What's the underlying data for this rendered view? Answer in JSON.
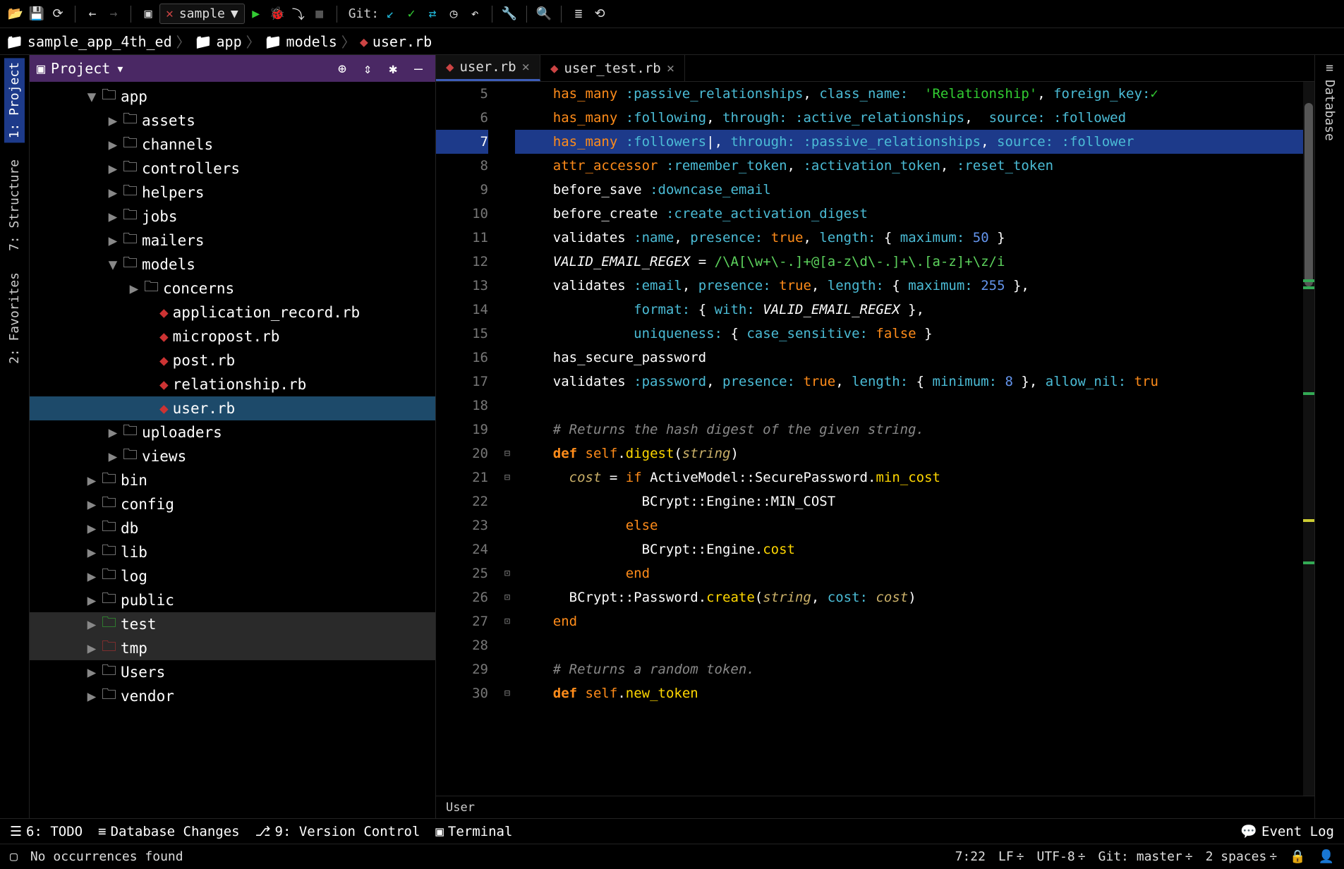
{
  "toolbar": {
    "run_config": "sample",
    "git_label": "Git:"
  },
  "breadcrumbs": [
    {
      "icon": "folder",
      "label": "sample_app_4th_ed"
    },
    {
      "icon": "folder",
      "label": "app"
    },
    {
      "icon": "folder",
      "label": "models"
    },
    {
      "icon": "ruby",
      "label": "user.rb"
    }
  ],
  "left_tabs": [
    {
      "label": "1: Project",
      "active": true
    },
    {
      "label": "7: Structure",
      "active": false
    },
    {
      "label": "2: Favorites",
      "active": false
    }
  ],
  "right_tabs": [
    {
      "label": "Database"
    }
  ],
  "project_panel": {
    "title": "Project",
    "tree": [
      {
        "indent": 80,
        "expand": "▼",
        "icon": "folder",
        "label": "app"
      },
      {
        "indent": 110,
        "expand": "▶",
        "icon": "folder",
        "label": "assets"
      },
      {
        "indent": 110,
        "expand": "▶",
        "icon": "folder",
        "label": "channels"
      },
      {
        "indent": 110,
        "expand": "▶",
        "icon": "folder",
        "label": "controllers"
      },
      {
        "indent": 110,
        "expand": "▶",
        "icon": "folder",
        "label": "helpers"
      },
      {
        "indent": 110,
        "expand": "▶",
        "icon": "folder",
        "label": "jobs"
      },
      {
        "indent": 110,
        "expand": "▶",
        "icon": "folder",
        "label": "mailers"
      },
      {
        "indent": 110,
        "expand": "▼",
        "icon": "folder",
        "label": "models"
      },
      {
        "indent": 140,
        "expand": "▶",
        "icon": "folder",
        "label": "concerns"
      },
      {
        "indent": 162,
        "expand": "",
        "icon": "ruby",
        "label": "application_record.rb"
      },
      {
        "indent": 162,
        "expand": "",
        "icon": "ruby",
        "label": "micropost.rb"
      },
      {
        "indent": 162,
        "expand": "",
        "icon": "ruby",
        "label": "post.rb"
      },
      {
        "indent": 162,
        "expand": "",
        "icon": "ruby",
        "label": "relationship.rb"
      },
      {
        "indent": 162,
        "expand": "",
        "icon": "ruby",
        "label": "user.rb",
        "selected": true
      },
      {
        "indent": 110,
        "expand": "▶",
        "icon": "folder",
        "label": "uploaders"
      },
      {
        "indent": 110,
        "expand": "▶",
        "icon": "folder",
        "label": "views"
      },
      {
        "indent": 80,
        "expand": "▶",
        "icon": "folder",
        "label": "bin"
      },
      {
        "indent": 80,
        "expand": "▶",
        "icon": "folder",
        "label": "config"
      },
      {
        "indent": 80,
        "expand": "▶",
        "icon": "folder",
        "label": "db"
      },
      {
        "indent": 80,
        "expand": "▶",
        "icon": "folder",
        "label": "lib"
      },
      {
        "indent": 80,
        "expand": "▶",
        "icon": "folder",
        "label": "log"
      },
      {
        "indent": 80,
        "expand": "▶",
        "icon": "folder",
        "label": "public"
      },
      {
        "indent": 80,
        "expand": "▶",
        "icon": "folder-test",
        "label": "test",
        "cls": "test dim"
      },
      {
        "indent": 80,
        "expand": "▶",
        "icon": "folder-tmp",
        "label": "tmp",
        "cls": "tmp dim"
      },
      {
        "indent": 80,
        "expand": "▶",
        "icon": "folder",
        "label": "Users"
      },
      {
        "indent": 80,
        "expand": "▶",
        "icon": "folder",
        "label": "vendor"
      }
    ]
  },
  "editor_tabs": [
    {
      "icon": "ruby",
      "label": "user.rb",
      "active": true
    },
    {
      "icon": "ruby",
      "label": "user_test.rb",
      "active": false
    }
  ],
  "editor": {
    "first_line": 5,
    "current_line": 7,
    "fold_markers": {
      "20": "⊟",
      "21": "⊟",
      "25": "⊡",
      "26": "⊡",
      "27": "⊡",
      "30": "⊟"
    },
    "lines": [
      {
        "n": 5,
        "html": "    <span class='kw'>has_many</span> <span class='sym'>:passive_relationships</span><span class='punct'>,</span> <span class='sym'>class_name:</span>  <span class='str'>'Relationship'</span><span class='punct'>,</span> <span class='sym'>foreign_key:</span><span class='green-check'>✓</span>"
      },
      {
        "n": 6,
        "html": "    <span class='kw'>has_many</span> <span class='sym'>:following</span><span class='punct'>,</span> <span class='sym'>through:</span> <span class='sym'>:active_relationships</span><span class='punct'>,</span>  <span class='sym'>source:</span> <span class='sym'>:followed</span>"
      },
      {
        "n": 7,
        "html": "    <span class='kw'>has_many</span> <span class='sym'>:followers</span><span class='punct'>|,</span> <span class='sym'>through:</span> <span class='sym'>:passive_relationships</span><span class='punct'>,</span> <span class='sym'>source:</span> <span class='sym'>:follower</span>"
      },
      {
        "n": 8,
        "html": "    <span class='kw'>attr_accessor</span> <span class='sym'>:remember_token</span><span class='punct'>,</span> <span class='sym'>:activation_token</span><span class='punct'>,</span> <span class='sym'>:reset_token</span>"
      },
      {
        "n": 9,
        "html": "    <span class='punct'>before_save</span> <span class='sym'>:downcase_email</span>"
      },
      {
        "n": 10,
        "html": "    <span class='punct'>before_create</span> <span class='sym'>:create_activation_digest</span>"
      },
      {
        "n": 11,
        "html": "    <span class='punct'>validates</span> <span class='sym'>:name</span><span class='punct'>,</span> <span class='sym'>presence:</span> <span class='kw'>true</span><span class='punct'>,</span> <span class='sym'>length:</span> <span class='punct'>{</span> <span class='sym'>maximum:</span> <span class='num'>50</span> <span class='punct'>}</span>"
      },
      {
        "n": 12,
        "html": "    <span class='const'>VALID_EMAIL_REGEX</span> <span class='punct'>=</span> <span class='regex'>/\\A[\\w+\\-.]+@[a-z\\d\\-.]+\\.[a-z]+\\z/i</span>"
      },
      {
        "n": 13,
        "html": "    <span class='punct'>validates</span> <span class='sym'>:email</span><span class='punct'>,</span> <span class='sym'>presence:</span> <span class='kw'>true</span><span class='punct'>,</span> <span class='sym'>length:</span> <span class='punct'>{</span> <span class='sym'>maximum:</span> <span class='num'>255</span> <span class='punct'>},</span>"
      },
      {
        "n": 14,
        "html": "              <span class='sym'>format:</span> <span class='punct'>{</span> <span class='sym'>with:</span> <span class='const'>VALID_EMAIL_REGEX</span> <span class='punct'>},</span>"
      },
      {
        "n": 15,
        "html": "              <span class='sym'>uniqueness:</span> <span class='punct'>{</span> <span class='sym'>case_sensitive:</span> <span class='kw'>false</span> <span class='punct'>}</span>"
      },
      {
        "n": 16,
        "html": "    <span class='punct'>has_secure_password</span>"
      },
      {
        "n": 17,
        "html": "    <span class='punct'>validates</span> <span class='sym'>:password</span><span class='punct'>,</span> <span class='sym'>presence:</span> <span class='kw'>true</span><span class='punct'>,</span> <span class='sym'>length:</span> <span class='punct'>{</span> <span class='sym'>minimum:</span> <span class='num'>8</span> <span class='punct'>},</span> <span class='sym'>allow_nil:</span> <span class='kw'>tru</span>"
      },
      {
        "n": 18,
        "html": ""
      },
      {
        "n": 19,
        "html": "    <span class='comment'># Returns the hash digest of the given string.</span>"
      },
      {
        "n": 20,
        "html": "    <span class='def'>def</span> <span class='kw'>self</span><span class='punct'>.</span><span class='method'>digest</span><span class='punct'>(</span><span class='param'>string</span><span class='punct'>)</span>"
      },
      {
        "n": 21,
        "html": "      <span class='param'>cost</span> <span class='punct'>=</span> <span class='kw'>if</span> <span class='const' style='font-style:normal'>ActiveModel</span><span class='punct'>::</span><span class='const' style='font-style:normal'>SecurePassword</span><span class='punct'>.</span><span class='method'>min_cost</span>"
      },
      {
        "n": 22,
        "html": "               <span class='const' style='font-style:normal'>BCrypt</span><span class='punct'>::</span><span class='const' style='font-style:normal'>Engine</span><span class='punct'>::</span><span class='const' style='font-style:normal'>MIN_COST</span>"
      },
      {
        "n": 23,
        "html": "             <span class='kw'>else</span>"
      },
      {
        "n": 24,
        "html": "               <span class='const' style='font-style:normal'>BCrypt</span><span class='punct'>::</span><span class='const' style='font-style:normal'>Engine</span><span class='punct'>.</span><span class='method'>cost</span>"
      },
      {
        "n": 25,
        "html": "             <span class='kw'>end</span>"
      },
      {
        "n": 26,
        "html": "      <span class='const' style='font-style:normal'>BCrypt</span><span class='punct'>::</span><span class='const' style='font-style:normal'>Password</span><span class='punct'>.</span><span class='method'>create</span><span class='punct'>(</span><span class='param'>string</span><span class='punct'>,</span> <span class='sym'>cost:</span> <span class='param'>cost</span><span class='punct'>)</span>"
      },
      {
        "n": 27,
        "html": "    <span class='kw'>end</span>"
      },
      {
        "n": 28,
        "html": ""
      },
      {
        "n": 29,
        "html": "    <span class='comment'># Returns a random token.</span>"
      },
      {
        "n": 30,
        "html": "    <span class='def'>def</span> <span class='kw'>self</span><span class='punct'>.</span><span class='method'>new_token</span>"
      }
    ],
    "breadcrumb": "User"
  },
  "bottom_tools": [
    {
      "icon": "☰",
      "label": "6: TODO"
    },
    {
      "icon": "≡",
      "label": "Database Changes"
    },
    {
      "icon": "⎇",
      "label": "9: Version Control"
    },
    {
      "icon": "▣",
      "label": "Terminal"
    }
  ],
  "event_log": "Event Log",
  "status": {
    "left_msg": "No occurrences found",
    "cursor": "7:22",
    "line_sep": "LF",
    "encoding": "UTF-8",
    "git_branch": "Git: master",
    "indent": "2 spaces",
    "lock_icon": "🔒"
  }
}
